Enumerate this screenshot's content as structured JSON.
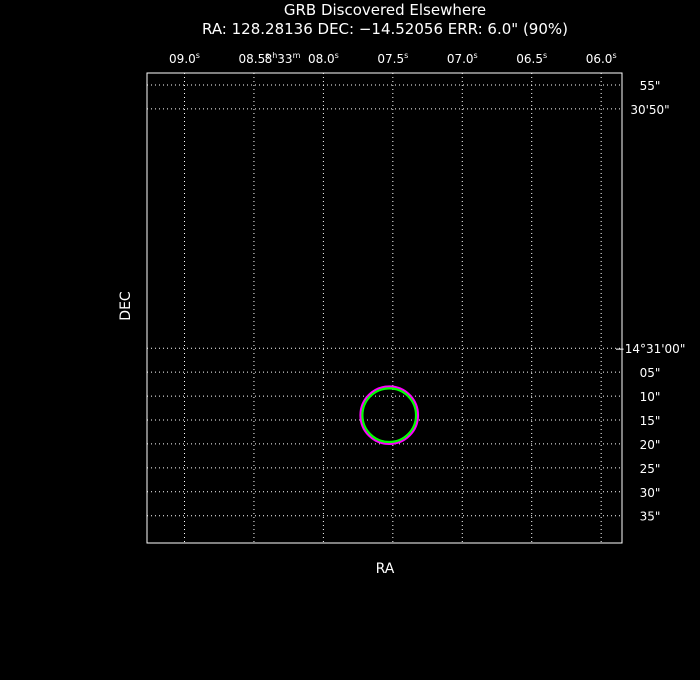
{
  "chart_data": {
    "type": "scatter",
    "title": "GRB Discovered Elsewhere",
    "subtitle": "RA: 128.28136  DEC: −14.52056  ERR: 6.0\" (90%)",
    "xlabel": "RA",
    "ylabel": "DEC",
    "grid": true,
    "frame_color": "#ffffff",
    "grid_color": "#ffffff",
    "background": "#000000",
    "x_ticks": [
      {
        "value": 9.0,
        "label": "09.0",
        "sup": "s"
      },
      {
        "value": 8.5,
        "label": "08.5",
        "sup": "s"
      },
      {
        "value": 8.0,
        "label": "08.0",
        "sup": "s",
        "prefix": "8",
        "prefix_sup_h": "h",
        "prefix_mid": "33",
        "prefix_sup_m": "m"
      },
      {
        "value": 7.5,
        "label": "07.5",
        "sup": "s"
      },
      {
        "value": 7.0,
        "label": "07.0",
        "sup": "s"
      },
      {
        "value": 6.5,
        "label": "06.5",
        "sup": "s"
      },
      {
        "value": 6.0,
        "label": "06.0",
        "sup": "s"
      }
    ],
    "xlim": [
      9.27,
      5.85
    ],
    "y_ticks": [
      {
        "value": -50,
        "label": "30'50\""
      },
      {
        "value": -55,
        "label": "55\""
      },
      {
        "value": 0,
        "label": "−14°31'00\""
      },
      {
        "value": 5,
        "label": "05\""
      },
      {
        "value": 10,
        "label": "10\""
      },
      {
        "value": 15,
        "label": "15\""
      },
      {
        "value": 20,
        "label": "20\""
      },
      {
        "value": 25,
        "label": "25\""
      },
      {
        "value": 30,
        "label": "30\""
      },
      {
        "value": 35,
        "label": "35\""
      }
    ],
    "ylim": [
      -57.5,
      40.7
    ],
    "error_circles": [
      {
        "name": "outer",
        "ra_s": 7.526,
        "dec_arcsec": 14.0,
        "radius_arcsec": 6.0,
        "color": "#ff00ff"
      },
      {
        "name": "inner",
        "ra_s": 7.526,
        "dec_arcsec": 14.0,
        "radius_arcsec": 5.6,
        "color": "#00ff00"
      }
    ]
  }
}
